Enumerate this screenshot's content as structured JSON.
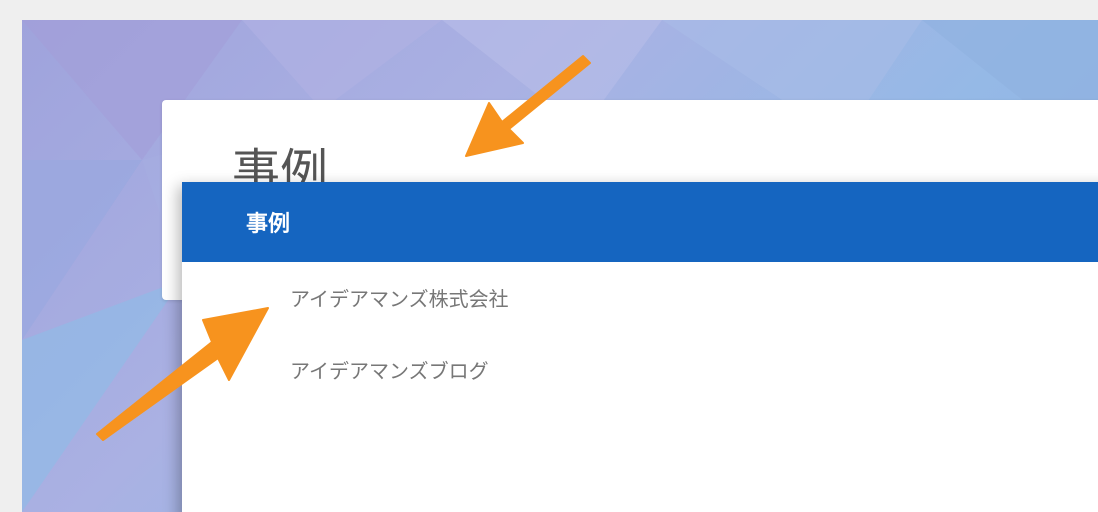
{
  "card": {
    "title": "事例"
  },
  "dropdown": {
    "header_label": "事例",
    "items": [
      {
        "label": "アイデアマンズ株式会社"
      },
      {
        "label": "アイデアマンズブログ"
      }
    ]
  },
  "colors": {
    "header_blue": "#1565c0",
    "arrow_orange": "#f7931e",
    "item_text": "#777777"
  },
  "icons": {
    "annotation": "arrow-icon"
  }
}
